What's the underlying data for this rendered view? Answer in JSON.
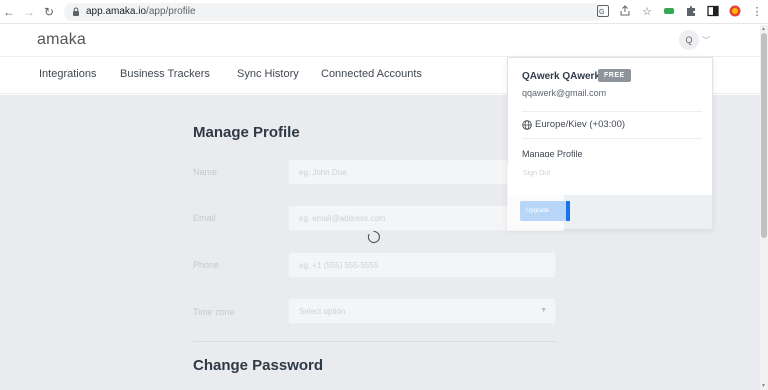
{
  "browser": {
    "url_host": "app.amaka.io",
    "url_path": "/app/profile"
  },
  "app": {
    "logo": "amaka",
    "avatar_initial": "Q"
  },
  "nav": {
    "items": [
      {
        "label": "Integrations"
      },
      {
        "label": "Business Trackers"
      },
      {
        "label": "Sync History"
      },
      {
        "label": "Connected Accounts"
      }
    ]
  },
  "profile": {
    "title": "Manage Profile",
    "fields": [
      {
        "label": "Name",
        "placeholder": "eg. John Doe"
      },
      {
        "label": "Email",
        "placeholder": "eg. email@address.com"
      },
      {
        "label": "Phone",
        "placeholder": "eg. +1 (555) 555-5555"
      },
      {
        "label": "Time zone",
        "placeholder": "Select option"
      }
    ]
  },
  "password": {
    "title": "Change Password"
  },
  "menu": {
    "name": "QAwerk QAwerk",
    "plan_badge": "FREE",
    "email": "qqawerk@gmail.com",
    "timezone": "Europe/Kiev (+03:00)",
    "manage_profile": "Manage Profile",
    "sign_out": "Sign Out",
    "upgrade": "Upgrade"
  },
  "colors": {
    "accent": "#1a73e8",
    "badge": "#8d949c",
    "main_bg": "#e9ebee"
  }
}
